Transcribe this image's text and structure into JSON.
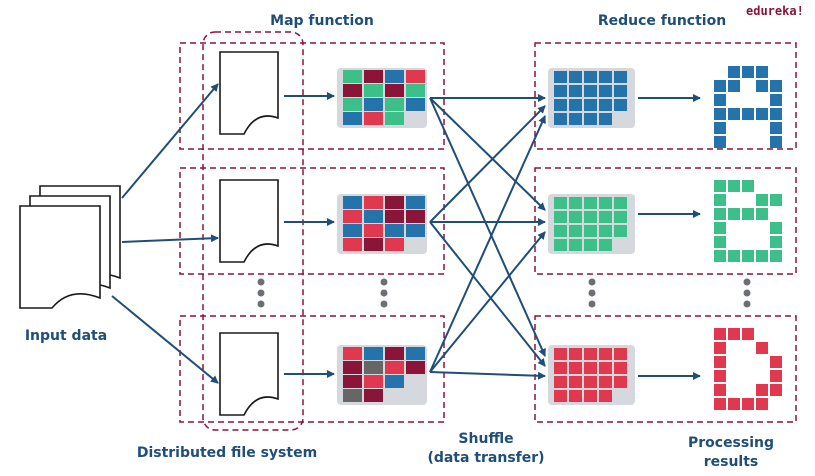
{
  "brand": "edureka!",
  "labels": {
    "map_function": "Map function",
    "reduce_function": "Reduce function",
    "input_data": "Input data",
    "distributed_fs": "Distributed file system",
    "shuffle_line1": "Shuffle",
    "shuffle_line2": "(data transfer)",
    "processing_line1": "Processing",
    "processing_line2": "results"
  },
  "colors": {
    "navy": "#1f4e79",
    "dashed_border": "#8a1538",
    "blue": "#2474ab",
    "green": "#3dbf8a",
    "red": "#e0394f",
    "maroon": "#8a1538",
    "gray": "#666666",
    "tray": "#d5d8dc"
  },
  "map_grids": [
    [
      [
        "green",
        "maroon",
        "blue",
        "red"
      ],
      [
        "maroon",
        "green",
        "maroon",
        "green"
      ],
      [
        "green",
        "blue",
        "green",
        "blue"
      ],
      [
        "blue",
        "red",
        "green",
        ""
      ]
    ],
    [
      [
        "blue",
        "red",
        "maroon",
        "blue"
      ],
      [
        "red",
        "blue",
        "maroon",
        "maroon"
      ],
      [
        "blue",
        "red",
        "blue",
        "blue"
      ],
      [
        "red",
        "maroon",
        "red",
        ""
      ]
    ],
    [
      [
        "red",
        "blue",
        "maroon",
        "blue"
      ],
      [
        "maroon",
        "gray",
        "red",
        "maroon"
      ],
      [
        "maroon",
        "red",
        "blue",
        ""
      ],
      [
        "gray",
        "maroon",
        "",
        ""
      ]
    ]
  ],
  "reduce_groups": [
    {
      "color": "blue",
      "letter": "A"
    },
    {
      "color": "green",
      "letter": "B"
    },
    {
      "color": "red",
      "letter": "D"
    }
  ],
  "letter_patterns": {
    "A": [
      [
        0,
        1,
        1,
        1,
        0
      ],
      [
        1,
        1,
        0,
        1,
        1
      ],
      [
        1,
        0,
        0,
        0,
        1
      ],
      [
        1,
        1,
        1,
        1,
        1
      ],
      [
        1,
        0,
        0,
        0,
        1
      ],
      [
        1,
        0,
        0,
        0,
        1
      ]
    ],
    "B": [
      [
        1,
        1,
        1,
        0,
        0
      ],
      [
        1,
        0,
        0,
        1,
        1
      ],
      [
        1,
        1,
        1,
        1,
        0
      ],
      [
        1,
        0,
        0,
        0,
        1
      ],
      [
        1,
        0,
        0,
        0,
        1
      ],
      [
        1,
        1,
        1,
        1,
        1
      ]
    ],
    "D": [
      [
        1,
        1,
        1,
        0,
        0
      ],
      [
        1,
        0,
        0,
        1,
        0
      ],
      [
        1,
        0,
        0,
        0,
        1
      ],
      [
        1,
        0,
        0,
        0,
        1
      ],
      [
        1,
        0,
        0,
        1,
        1
      ],
      [
        1,
        1,
        1,
        1,
        0
      ]
    ]
  }
}
